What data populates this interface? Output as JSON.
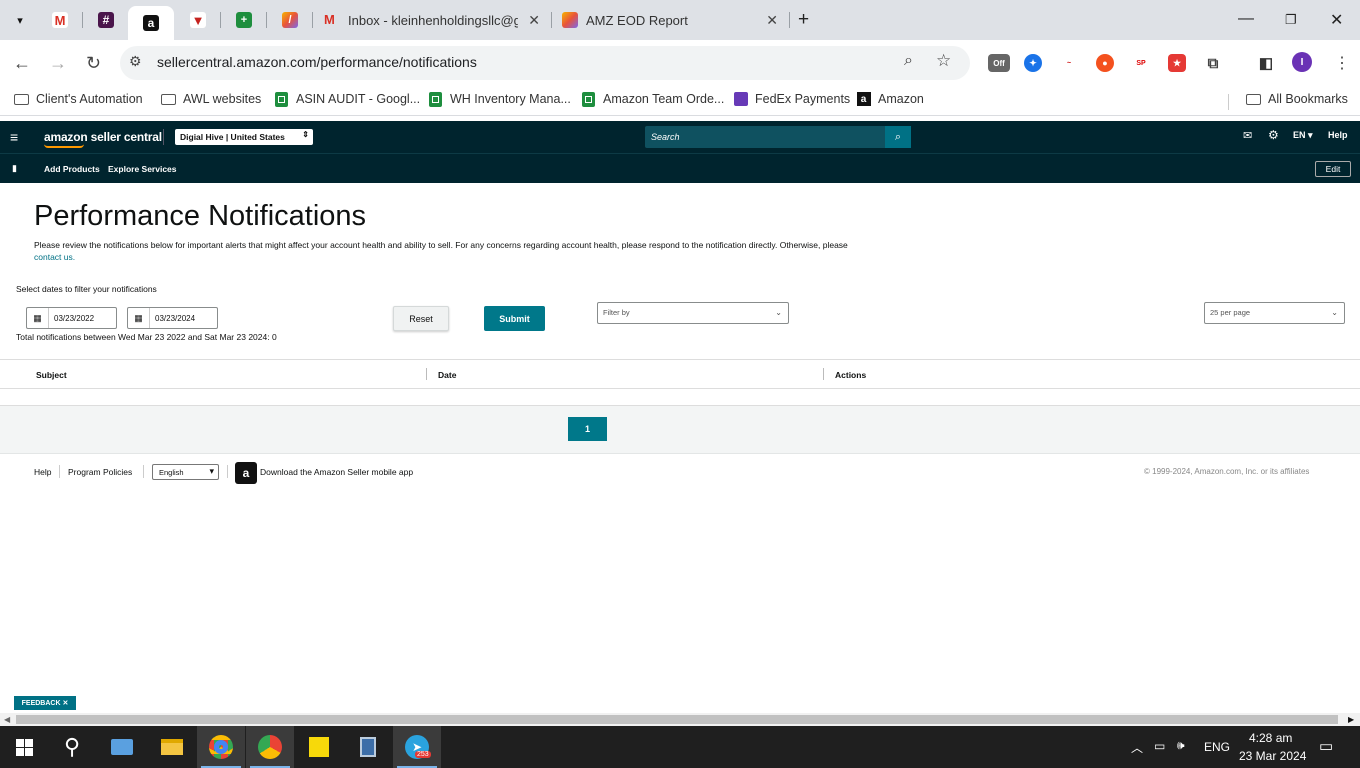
{
  "browser": {
    "tabs": {
      "inbox_title": "Inbox - kleinhenholdingsllc@gm",
      "eod_title": "AMZ EOD Report"
    },
    "url": "sellercentral.amazon.com/performance/notifications",
    "bookmarks": [
      {
        "label": "Client's Automation",
        "icon": "folder-icon"
      },
      {
        "label": "AWL websites",
        "icon": "folder-icon"
      },
      {
        "label": "ASIN AUDIT - Googl...",
        "icon": "sheets-icon"
      },
      {
        "label": "WH Inventory Mana...",
        "icon": "sheets-icon"
      },
      {
        "label": "Amazon Team Orde...",
        "icon": "sheets-icon"
      },
      {
        "label": "FedEx Payments",
        "icon": "forms-icon"
      },
      {
        "label": "Amazon",
        "icon": "amazon-icon"
      }
    ],
    "all_bookmarks": "All Bookmarks",
    "profile_initial": "I",
    "ext_badge": "Off"
  },
  "seller_central": {
    "logo": "amazon seller central",
    "account": "Digial Hive | United States",
    "search_placeholder": "Search",
    "lang": "EN",
    "help": "Help",
    "nav": {
      "add_products": "Add Products",
      "explore_services": "Explore Services",
      "edit": "Edit"
    }
  },
  "page": {
    "title": "Performance Notifications",
    "description": "Please review the notifications below for important alerts that might affect your account health and ability to sell. For any concerns regarding account health, please respond to the notification directly. Otherwise, please",
    "contact_link": "contact us.",
    "filter_label": "Select dates to filter your notifications",
    "date_from": "03/23/2022",
    "date_to": "03/23/2024",
    "reset": "Reset",
    "submit": "Submit",
    "filter_placeholder": "Filter by",
    "per_page": "25 per page",
    "total": "Total notifications between Wed Mar 23 2022 and Sat Mar 23 2024: 0",
    "columns": {
      "subject": "Subject",
      "date": "Date",
      "actions": "Actions"
    },
    "page_number": "1"
  },
  "footer": {
    "help": "Help",
    "program_policies": "Program Policies",
    "language": "English",
    "app_text": "Download the Amazon Seller mobile app",
    "copyright": "© 1999-2024, Amazon.com, Inc. or its affiliates"
  },
  "feedback": "FEEDBACK",
  "taskbar": {
    "telegram_badge": "253",
    "lang": "ENG",
    "time": "4:28 am",
    "date": "23 Mar 2024"
  },
  "colors": {
    "sc_nav": "#00242e",
    "teal": "#007185",
    "submit": "#00788a"
  }
}
